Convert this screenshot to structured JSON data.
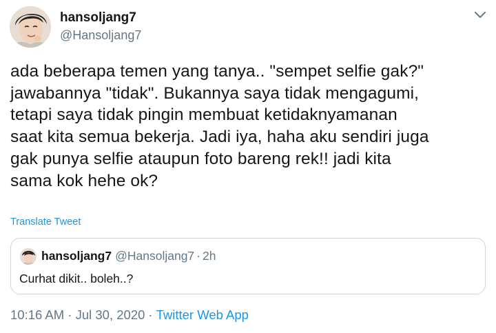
{
  "tweet": {
    "display_name": "hansoljang7",
    "handle": "@Hansoljang7",
    "text": "ada beberapa temen yang tanya.. \"sempet selfie gak?\"\njawabannya \"tidak\". Bukannya saya tidak mengagumi,\ntetapi saya tidak pingin membuat ketidaknyamanan\nsaat kita semua bekerja. Jadi iya, haha aku sendiri juga\ngak punya selfie ataupun foto bareng rek!! jadi kita\nsama kok hehe ok?",
    "translate_label": "Translate Tweet",
    "timestamp": "10:16 AM · Jul 30, 2020",
    "separator": "·",
    "source": "Twitter Web App",
    "menu_icon": "chevron-down-icon"
  },
  "quoted_tweet": {
    "display_name": "hansoljang7",
    "handle": "@Hansoljang7",
    "dot": "·",
    "time": "2h",
    "text": "Curhat dikit.. boleh..?"
  },
  "colors": {
    "text": "#14171a",
    "secondary": "#657786",
    "link": "#1b95e0",
    "border": "#ccd6dd"
  }
}
